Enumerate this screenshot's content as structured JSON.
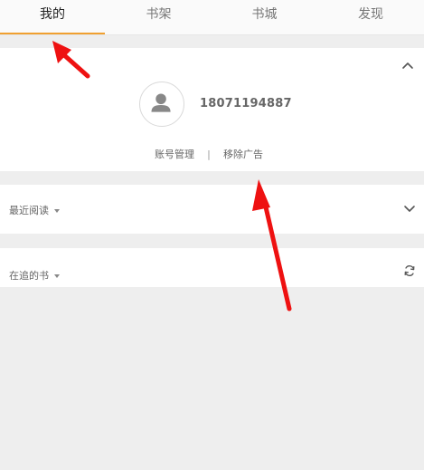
{
  "tabs": [
    {
      "label": "我的"
    },
    {
      "label": "书架"
    },
    {
      "label": "书城"
    },
    {
      "label": "发现"
    }
  ],
  "active_tab_index": 0,
  "profile": {
    "phone": "18071194887",
    "account_manage": "账号管理",
    "separator": "|",
    "remove_ads": "移除广告"
  },
  "sections": {
    "recent_reading": "最近阅读",
    "following_books": "在追的书"
  },
  "icons": {
    "avatar": "user-placeholder-icon",
    "collapse": "chevron-up-icon",
    "expand": "chevron-down-icon",
    "refresh": "refresh-icon",
    "dropdown": "caret-down-icon"
  },
  "colors": {
    "accent": "#f0a030",
    "annotation_arrow": "#ee1111",
    "background": "#eeeeee"
  }
}
